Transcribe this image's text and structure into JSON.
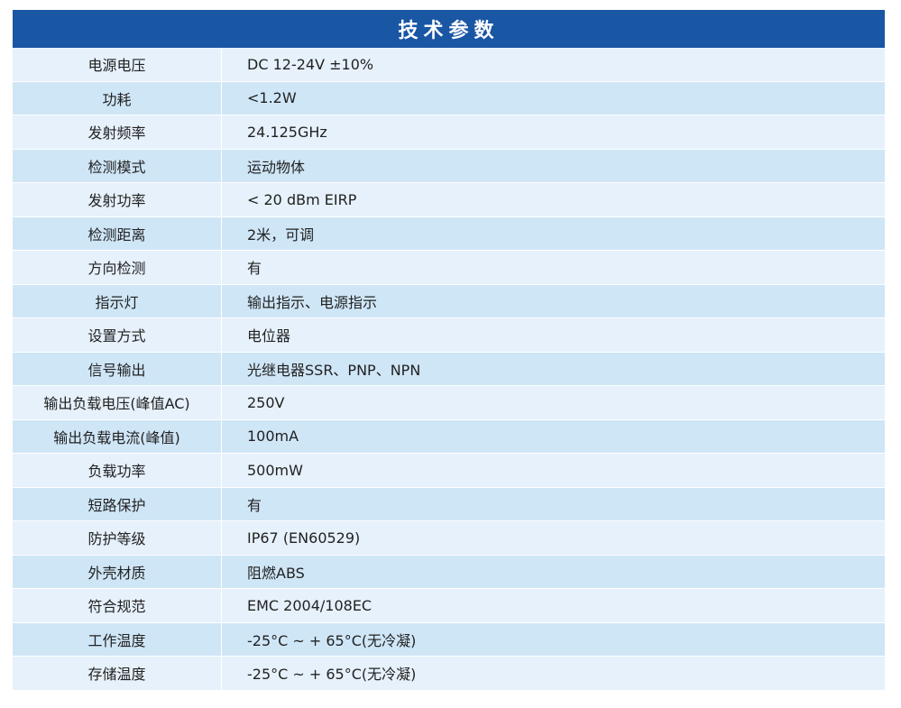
{
  "header": {
    "title": "技术参数"
  },
  "colors": {
    "header_bg": "#1956a4",
    "row_light": "#e6f1fb",
    "row_dark": "#cfe6f7"
  },
  "rows": [
    {
      "label": "电源电压",
      "value": "DC 12-24V ±10%"
    },
    {
      "label": "功耗",
      "value": "<1.2W"
    },
    {
      "label": "发射频率",
      "value": "24.125GHz"
    },
    {
      "label": "检测模式",
      "value": "运动物体"
    },
    {
      "label": "发射功率",
      "value": "< 20 dBm EIRP"
    },
    {
      "label": "检测距离",
      "value": "2米，可调"
    },
    {
      "label": "方向检测",
      "value": "有"
    },
    {
      "label": "指示灯",
      "value": "输出指示、电源指示"
    },
    {
      "label": "设置方式",
      "value": "电位器"
    },
    {
      "label": "信号输出",
      "value": "光继电器SSR、PNP、NPN"
    },
    {
      "label": "输出负载电压(峰值AC)",
      "value": "250V"
    },
    {
      "label": "输出负载电流(峰值)",
      "value": "100mA"
    },
    {
      "label": "负载功率",
      "value": "500mW"
    },
    {
      "label": "短路保护",
      "value": "有"
    },
    {
      "label": "防护等级",
      "value": "IP67 (EN60529)"
    },
    {
      "label": "外壳材质",
      "value": "阻燃ABS"
    },
    {
      "label": "符合规范",
      "value": "EMC 2004/108EC"
    },
    {
      "label": "工作温度",
      "value": "-25°C ~ + 65°C(无冷凝)"
    },
    {
      "label": "存储温度",
      "value": "-25°C ~ + 65°C(无冷凝)"
    }
  ]
}
